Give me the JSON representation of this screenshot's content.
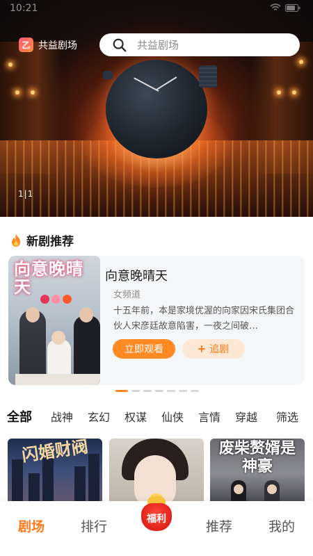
{
  "status_bar": {
    "time": "10:21"
  },
  "brand": {
    "logo_glyph": "乙",
    "name": "共益剧场"
  },
  "search": {
    "placeholder": "共益剧场"
  },
  "hero": {
    "counter": "1|1"
  },
  "section": {
    "title": "新剧推荐"
  },
  "recommendation": {
    "poster_title": "向意晚晴天",
    "title": "向意晚晴天",
    "channel": "女频道",
    "description": "十五年前，本是家境优渥的向家因宋氏集团合伙人宋彦廷故意陷害，一夜之间破…",
    "watch_label": "立即观看",
    "follow_label": "追剧",
    "follow_icon": "+"
  },
  "carousel": {
    "count": 7,
    "active_index": 0
  },
  "tabs": [
    {
      "label": "全部",
      "active": true
    },
    {
      "label": "战神",
      "active": false
    },
    {
      "label": "玄幻",
      "active": false
    },
    {
      "label": "权谋",
      "active": false
    },
    {
      "label": "仙侠",
      "active": false
    },
    {
      "label": "言情",
      "active": false
    },
    {
      "label": "穿越",
      "active": false
    },
    {
      "label": "筛选",
      "active": false
    }
  ],
  "posters": [
    {
      "title": "闪婚财阀"
    },
    {
      "title": ""
    },
    {
      "title": "废柴赘婿是神豪"
    }
  ],
  "bottom_nav": [
    {
      "label": "剧场",
      "active": true
    },
    {
      "label": "排行",
      "active": false
    },
    {
      "label": "福利",
      "active": false
    },
    {
      "label": "推荐",
      "active": false
    },
    {
      "label": "我的",
      "active": false
    }
  ],
  "colors": {
    "accent": "#ff8a24",
    "accent_text": "#ff7a1a",
    "follow_bg": "#fde8d6"
  }
}
